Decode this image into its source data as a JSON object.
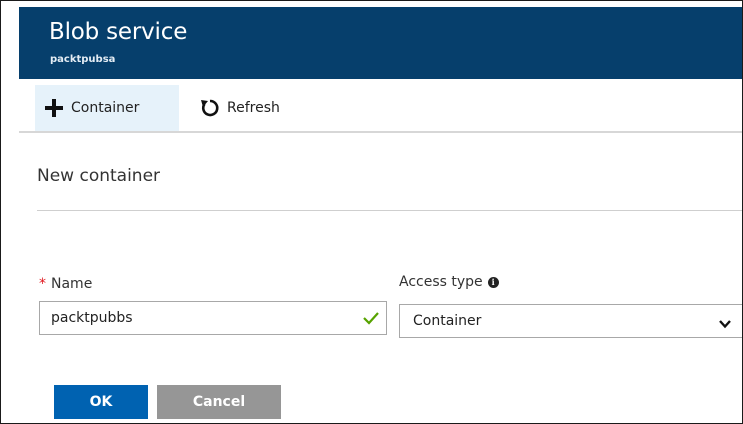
{
  "header": {
    "title": "Blob service",
    "subtitle": "packtpubsa",
    "color": "#063f6c"
  },
  "toolbar": {
    "container_label": "Container",
    "container_icon": "plus-icon",
    "refresh_label": "Refresh",
    "refresh_icon": "refresh-icon"
  },
  "panel": {
    "title": "New container",
    "name_field": {
      "required_marker": "*",
      "label": "Name",
      "value": "packtpubbs",
      "valid": true,
      "valid_icon": "checkmark-icon",
      "valid_color": "#57a300"
    },
    "access_field": {
      "label": "Access type",
      "info_icon": "info-icon",
      "info_glyph": "i",
      "selected": "Container",
      "dropdown_icon": "chevron-down-icon"
    }
  },
  "actions": {
    "ok_label": "OK",
    "cancel_label": "Cancel",
    "ok_color": "#0062b1",
    "cancel_color": "#969696"
  }
}
